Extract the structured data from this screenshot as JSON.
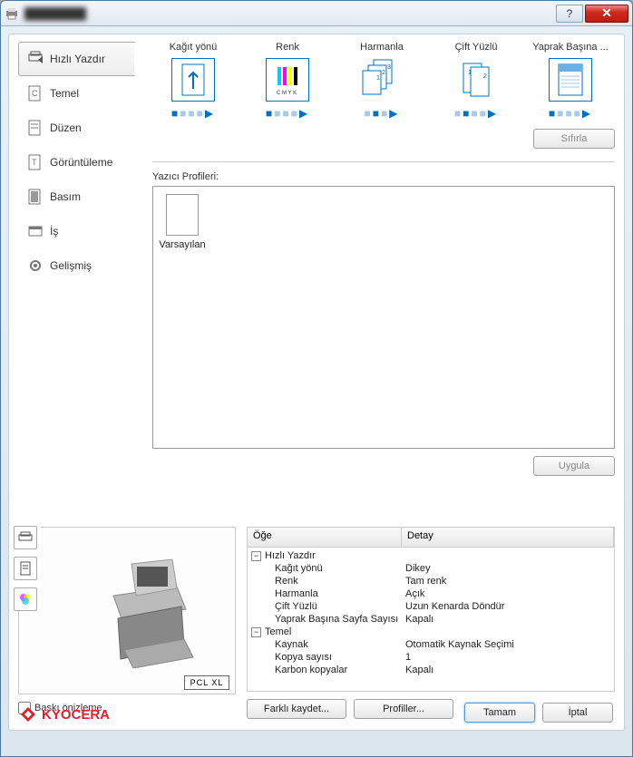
{
  "window": {
    "title": "████████"
  },
  "sidebar": {
    "tabs": [
      {
        "label": "Hızlı Yazdır"
      },
      {
        "label": "Temel"
      },
      {
        "label": "Düzen"
      },
      {
        "label": "Görüntüleme"
      },
      {
        "label": "Basım"
      },
      {
        "label": "İş"
      },
      {
        "label": "Gelişmiş"
      }
    ]
  },
  "options": [
    {
      "label": "Kağıt yönü"
    },
    {
      "label": "Renk"
    },
    {
      "label": "Harmanla"
    },
    {
      "label": "Çift Yüzlü"
    },
    {
      "label": "Yaprak Başına ..."
    }
  ],
  "buttons": {
    "reset": "Sıfırla",
    "apply": "Uygula",
    "saveas": "Farklı kaydet...",
    "profiles": "Profiller...",
    "ok": "Tamam",
    "cancel": "İptal"
  },
  "profiles_section": {
    "label": "Yazıcı Profileri:",
    "default": "Varsayılan"
  },
  "preview_chk": "Baskı önizleme",
  "pcl_badge": "PCL XL",
  "table": {
    "headers": [
      "Öğe",
      "Detay"
    ],
    "rows": [
      {
        "group": true,
        "c1": "Hızlı Yazdır",
        "c2": ""
      },
      {
        "c1": "Kağıt yönü",
        "c2": "Dikey"
      },
      {
        "c1": "Renk",
        "c2": "Tam renk"
      },
      {
        "c1": "Harmanla",
        "c2": "Açık"
      },
      {
        "c1": "Çift Yüzlü",
        "c2": "Uzun Kenarda Döndür"
      },
      {
        "c1": "Yaprak Başına Sayfa Sayısı",
        "c2": "Kapalı"
      },
      {
        "group": true,
        "c1": "Temel",
        "c2": ""
      },
      {
        "c1": "Kaynak",
        "c2": "Otomatik Kaynak Seçimi"
      },
      {
        "c1": "Kopya sayısı",
        "c2": "1"
      },
      {
        "c1": "Karbon kopyalar",
        "c2": "Kapalı"
      }
    ]
  },
  "brand": "KYOCERA"
}
